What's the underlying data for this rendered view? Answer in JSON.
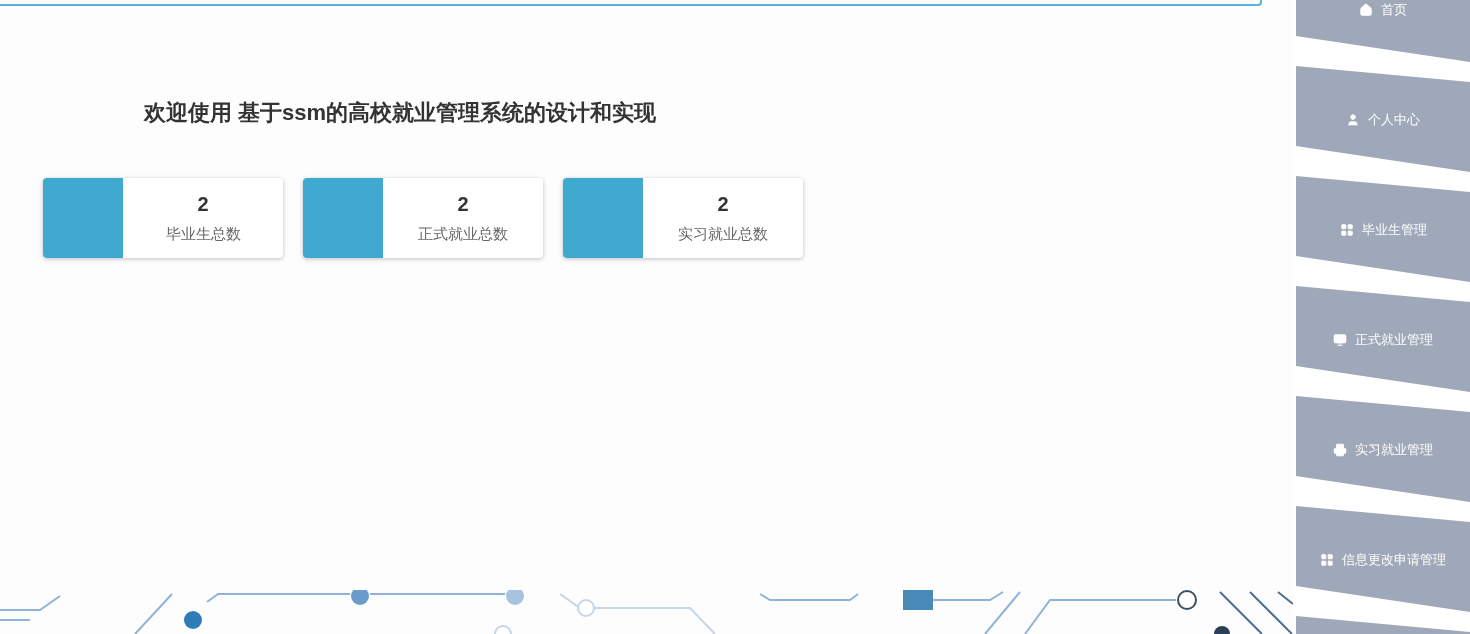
{
  "welcome_title": "欢迎使用 基于ssm的高校就业管理系统的设计和实现",
  "stat_cards": [
    {
      "count": "2",
      "label": "毕业生总数"
    },
    {
      "count": "2",
      "label": "正式就业总数"
    },
    {
      "count": "2",
      "label": "实习就业总数"
    }
  ],
  "sidebar": {
    "items": [
      {
        "label": "首页"
      },
      {
        "label": "个人中心"
      },
      {
        "label": "毕业生管理"
      },
      {
        "label": "正式就业管理"
      },
      {
        "label": "实习就业管理"
      },
      {
        "label": "信息更改申请管理"
      }
    ]
  }
}
